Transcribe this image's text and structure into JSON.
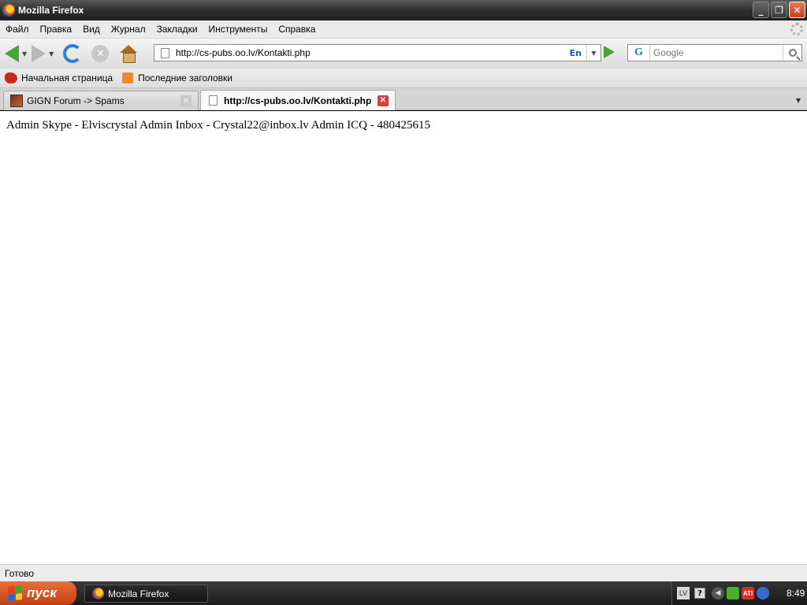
{
  "window": {
    "title": "Mozilla Firefox",
    "minimize": "_",
    "maximize": "❐",
    "close": "✕"
  },
  "menu": {
    "items": [
      "Файл",
      "Правка",
      "Вид",
      "Журнал",
      "Закладки",
      "Инструменты",
      "Справка"
    ]
  },
  "nav": {
    "url": "http://cs-pubs.oo.lv/Kontakti.php",
    "lang_indicator": "En",
    "search_placeholder": "Google",
    "search_engine": "G"
  },
  "bookmarks": {
    "items": [
      "Начальная страница",
      "Последние заголовки"
    ]
  },
  "tabs": [
    {
      "label": "GIGN Forum -> Spams",
      "active": false
    },
    {
      "label": "http://cs-pubs.oo.lv/Kontakti.php",
      "active": true
    }
  ],
  "page": {
    "text": "Admin Skype - Elviscrystal Admin Inbox - Crystal22@inbox.lv Admin ICQ - 480425615"
  },
  "status": {
    "text": "Готово"
  },
  "taskbar": {
    "start_label": "пуск",
    "task_label": "Mozilla Firefox",
    "tray_lang": "LV",
    "tray_help": "?",
    "tray_ati": "ATI",
    "clock": "8:49"
  },
  "colors": {
    "tab_close_active": "#d8403a",
    "start_button": "#c43e10",
    "nav_green": "#4aa23a"
  }
}
